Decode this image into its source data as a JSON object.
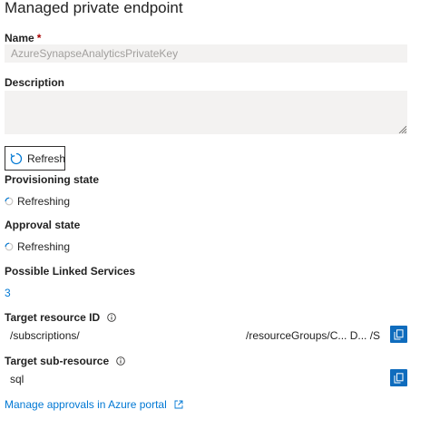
{
  "title": "Managed private endpoint",
  "name_field": {
    "label": "Name",
    "required_mark": "*",
    "value": "AzureSynapseAnalyticsPrivateKey"
  },
  "description_field": {
    "label": "Description",
    "value": ""
  },
  "refresh_button": {
    "label": "Refresh",
    "icon": "refresh-icon"
  },
  "provisioning_state": {
    "label": "Provisioning state",
    "status": "Refreshing",
    "icon": "spinner-icon"
  },
  "approval_state": {
    "label": "Approval state",
    "status": "Refreshing",
    "icon": "spinner-icon"
  },
  "linked_services": {
    "label": "Possible Linked Services",
    "count": "3"
  },
  "target_resource": {
    "label": "Target resource ID",
    "value_start": "/subscriptions/",
    "value_end": "/resourceGroups/C... D... /S... M...",
    "info_icon": "info-icon",
    "copy_icon": "copy-icon"
  },
  "target_subresource": {
    "label": "Target sub-resource",
    "value": "sql",
    "info_icon": "info-icon",
    "copy_icon": "copy-icon"
  },
  "manage_link": {
    "label": "Manage approvals in Azure portal",
    "icon": "external-link-icon"
  },
  "colors": {
    "link": "#0078d4",
    "copy_button": "#0f6cbd",
    "field_background": "#f3f2f1",
    "required": "#a80000"
  }
}
